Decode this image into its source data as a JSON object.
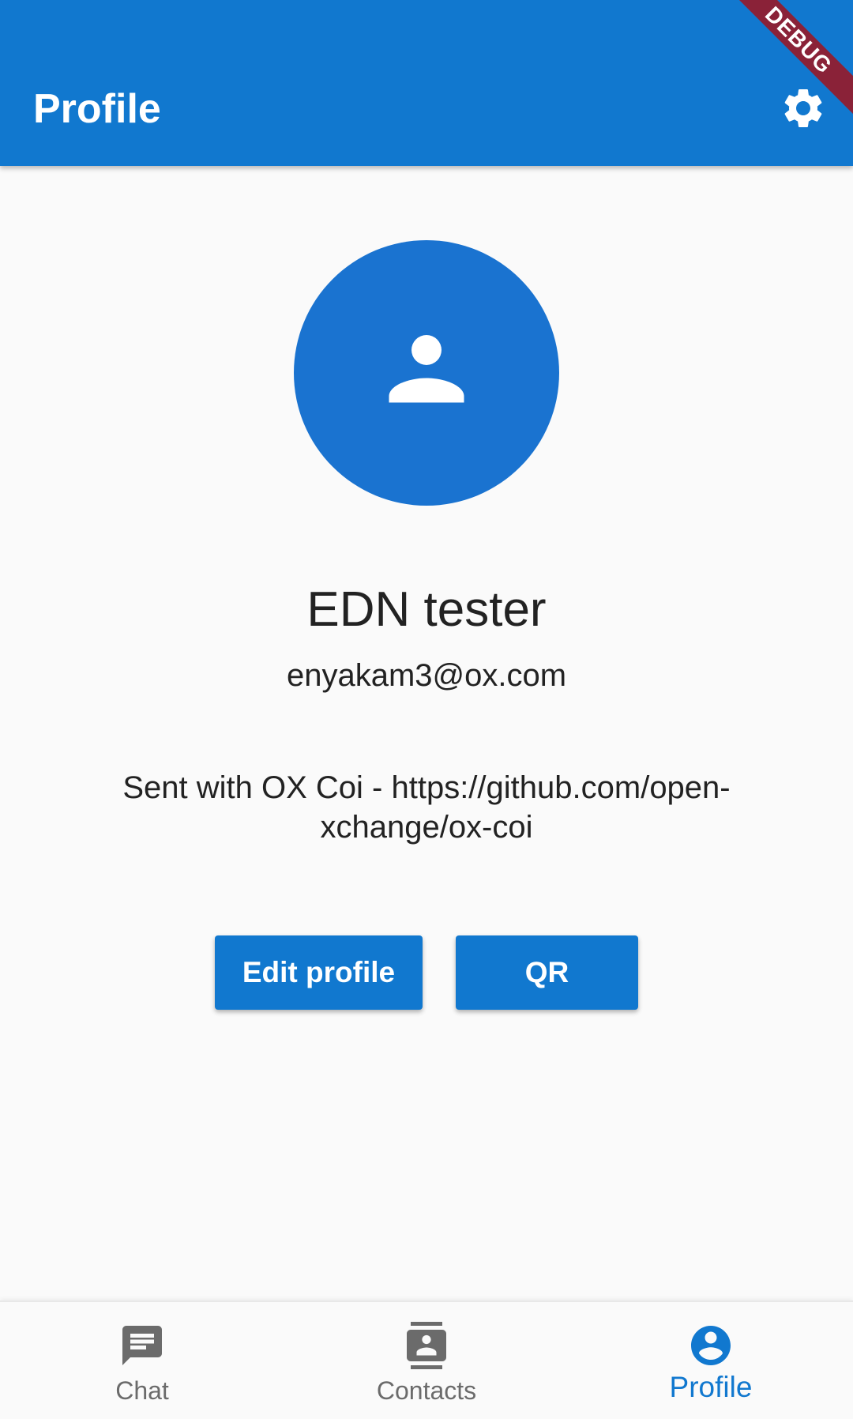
{
  "app_bar": {
    "title": "Profile",
    "settings_icon": "gear-icon",
    "debug_banner": "DEBUG",
    "color": "#1178cf"
  },
  "profile": {
    "avatar_icon": "person-icon",
    "name": "EDN tester",
    "email": "enyakam3@ox.com",
    "signature": "Sent with OX Coi - https://github.com/open-xchange/ox-coi"
  },
  "actions": {
    "edit_label": "Edit profile",
    "qr_label": "QR"
  },
  "bottom_nav": {
    "items": [
      {
        "label": "Chat",
        "icon": "chat-icon",
        "active": false
      },
      {
        "label": "Contacts",
        "icon": "contacts-icon",
        "active": false
      },
      {
        "label": "Profile",
        "icon": "account-circle-icon",
        "active": true
      }
    ],
    "active_color": "#1178cf",
    "inactive_color": "#6b6b6b"
  }
}
